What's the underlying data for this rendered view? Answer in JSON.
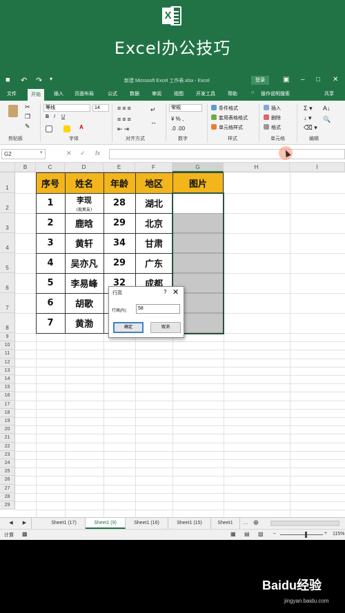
{
  "banner": {
    "logo_letter": "X",
    "title": "Excel办公技巧"
  },
  "titlebar": {
    "save_icon": "save-icon",
    "undo_icon": "undo-icon",
    "redo_icon": "redo-icon",
    "window_title": "新建 Microsoft Excel 工作表.xlsx  -  Excel",
    "login_label": "登录"
  },
  "tabs": [
    "文件",
    "开始",
    "插入",
    "页面布局",
    "公式",
    "数据",
    "审阅",
    "视图",
    "开发工具",
    "帮助",
    "操作说明搜索",
    "共享"
  ],
  "ribbon": {
    "font_name": "等线",
    "font_size": "14",
    "number_format": "常规",
    "groups": [
      "剪贴板",
      "字体",
      "对齐方式",
      "数字",
      "样式",
      "单元格",
      "编辑"
    ],
    "styles_items": [
      "条件格式",
      "套用表格格式",
      "单元格样式"
    ],
    "cells_items": [
      "插入",
      "删除",
      "格式"
    ]
  },
  "formula_bar": {
    "name_box": "G2",
    "fx": "fx",
    "value": ""
  },
  "columns": [
    "B",
    "C",
    "D",
    "E",
    "F",
    "G",
    "H",
    "I"
  ],
  "selected_column": "G",
  "rows": [
    "1",
    "2",
    "3",
    "4",
    "5",
    "6",
    "7",
    "8",
    "9",
    "10",
    "11",
    "12",
    "13",
    "14",
    "15",
    "16",
    "17",
    "18",
    "19",
    "20",
    "21",
    "22",
    "23",
    "24",
    "25",
    "26",
    "27",
    "28",
    "29"
  ],
  "table": {
    "headers": [
      "序号",
      "姓名",
      "年龄",
      "地区",
      "图片"
    ],
    "rows": [
      {
        "no": "1",
        "name": "李现",
        "name_note": "(现男友)",
        "age": "28",
        "region": "湖北"
      },
      {
        "no": "2",
        "name": "鹿晗",
        "age": "29",
        "region": "北京"
      },
      {
        "no": "3",
        "name": "黄轩",
        "age": "34",
        "region": "甘肃"
      },
      {
        "no": "4",
        "name": "吴亦凡",
        "age": "29",
        "region": "广东"
      },
      {
        "no": "5",
        "name": "李易峰",
        "age": "32",
        "region": "成都"
      },
      {
        "no": "6",
        "name": "胡歌",
        "age": "",
        "region": ""
      },
      {
        "no": "7",
        "name": "黄渤",
        "age": "",
        "region": ""
      }
    ]
  },
  "dialog": {
    "title": "行高",
    "help": "?",
    "close": "✕",
    "field_label": "行高(R):",
    "field_value": "58",
    "ok_label": "确定",
    "cancel_label": "取消"
  },
  "sheet_tabs": [
    "Sheet1 (17)",
    "Sheet1 (9)",
    "Sheet1 (16)",
    "Sheet1 (15)",
    "Sheet1"
  ],
  "active_sheet": "Sheet1 (9)",
  "status": {
    "mode": "计算",
    "zoom": "115%"
  },
  "watermark": {
    "brand": "Baidu经验",
    "url": "jingyan.baidu.com"
  }
}
